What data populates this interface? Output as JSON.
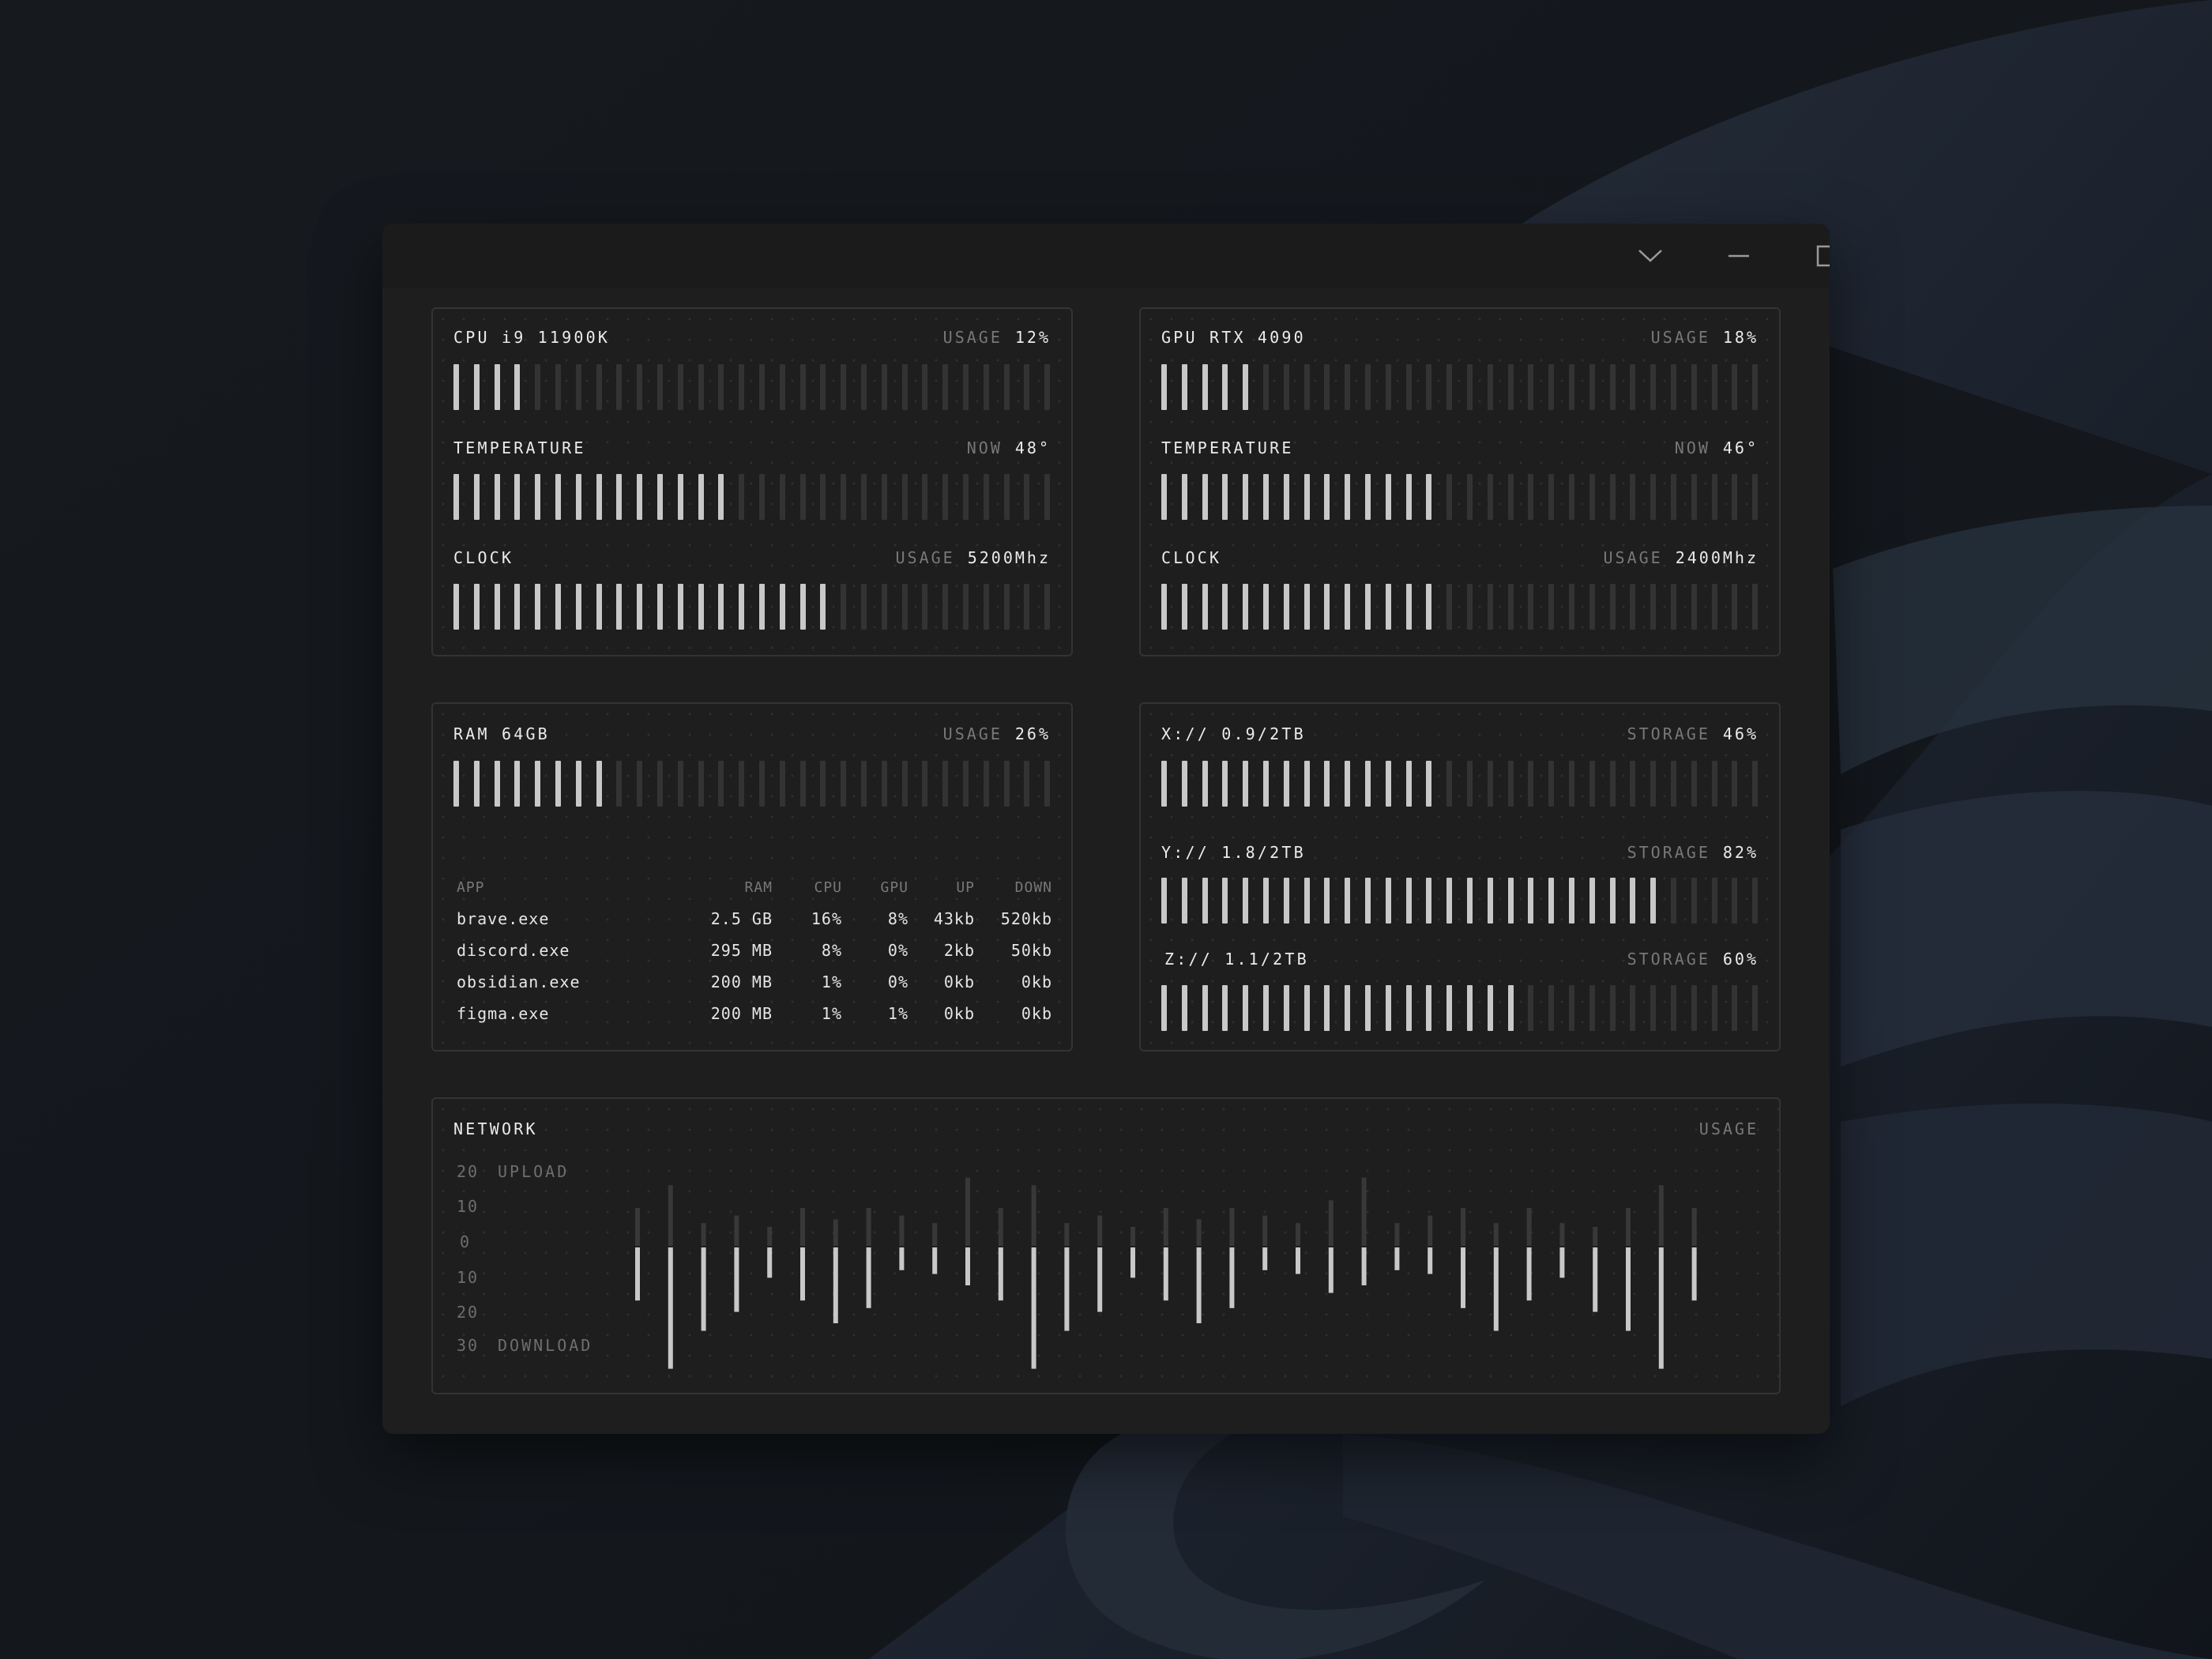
{
  "window_controls": {
    "collapse_icon": "chevron-down-icon",
    "minimize_icon": "minimize-icon",
    "maximize_icon": "maximize-icon",
    "close_icon": "close-icon"
  },
  "colors": {
    "bar_active": "#c8c8c8",
    "bar_inactive": "#333333",
    "panel_border": "#333333",
    "window_bg": "#1e1e1e"
  },
  "cpu": {
    "title": "CPU i9 11900K",
    "usage": {
      "label": "USAGE",
      "value": "12%",
      "fraction": 0.12
    },
    "temperature": {
      "label": "TEMPERATURE",
      "stat_label": "NOW",
      "value": "48°",
      "fraction": 0.48
    },
    "clock": {
      "label": "CLOCK",
      "stat_label": "USAGE",
      "value": "5200Mhz",
      "fraction": 0.62
    }
  },
  "gpu": {
    "title": "GPU RTX 4090",
    "usage": {
      "label": "USAGE",
      "value": "18%",
      "fraction": 0.18
    },
    "temperature": {
      "label": "TEMPERATURE",
      "stat_label": "NOW",
      "value": "46°",
      "fraction": 0.46
    },
    "clock": {
      "label": "CLOCK",
      "stat_label": "USAGE",
      "value": "2400Mhz",
      "fraction": 0.48
    }
  },
  "ram": {
    "title": "RAM 64GB",
    "usage": {
      "label": "USAGE",
      "value": "26%",
      "fraction": 0.26
    },
    "table": {
      "headers": [
        "APP",
        "RAM",
        "CPU",
        "GPU",
        "UP",
        "DOWN"
      ],
      "rows": [
        [
          "brave.exe",
          "2.5 GB",
          "16%",
          "8%",
          "43kb",
          "520kb"
        ],
        [
          "discord.exe",
          "295 MB",
          "8%",
          "0%",
          "2kb",
          "50kb"
        ],
        [
          "obsidian.exe",
          "200 MB",
          "1%",
          "0%",
          "0kb",
          "0kb"
        ],
        [
          "figma.exe",
          "200 MB",
          "1%",
          "1%",
          "0kb",
          "0kb"
        ]
      ]
    }
  },
  "storage": {
    "drives": [
      {
        "name": "X:// 0.9/2TB",
        "label": "STORAGE",
        "value": "46%",
        "fraction": 0.46
      },
      {
        "name": "Y:// 1.8/2TB",
        "label": "STORAGE",
        "value": "82%",
        "fraction": 0.82
      },
      {
        "name": "Z:// 1.1/2TB",
        "label": "STORAGE",
        "value": "60%",
        "fraction": 0.6
      }
    ]
  },
  "network": {
    "title": "NETWORK",
    "stat_label": "USAGE",
    "upload_label": "UPLOAD",
    "download_label": "DOWNLOAD",
    "axis_ticks": [
      "20",
      "10",
      "0",
      "10",
      "20",
      "30"
    ],
    "chart_data": {
      "type": "bar",
      "series": [
        {
          "name": "UPLOAD",
          "values": [
            10,
            16,
            6,
            8,
            5,
            10,
            7,
            10,
            8,
            6,
            18,
            10,
            16,
            6,
            8,
            5,
            10,
            7,
            10,
            8,
            6,
            12,
            18,
            6,
            8,
            10,
            6,
            10,
            6,
            5,
            10,
            16,
            10
          ]
        },
        {
          "name": "DOWNLOAD",
          "values": [
            -14,
            -32,
            -22,
            -17,
            -8,
            -14,
            -20,
            -16,
            -6,
            -7,
            -10,
            -14,
            -32,
            -22,
            -17,
            -8,
            -14,
            -20,
            -16,
            -6,
            -7,
            -12,
            -10,
            -6,
            -7,
            -16,
            -22,
            -14,
            -8,
            -17,
            -22,
            -32,
            -14
          ]
        }
      ],
      "ylim": [
        -30,
        20
      ]
    }
  }
}
